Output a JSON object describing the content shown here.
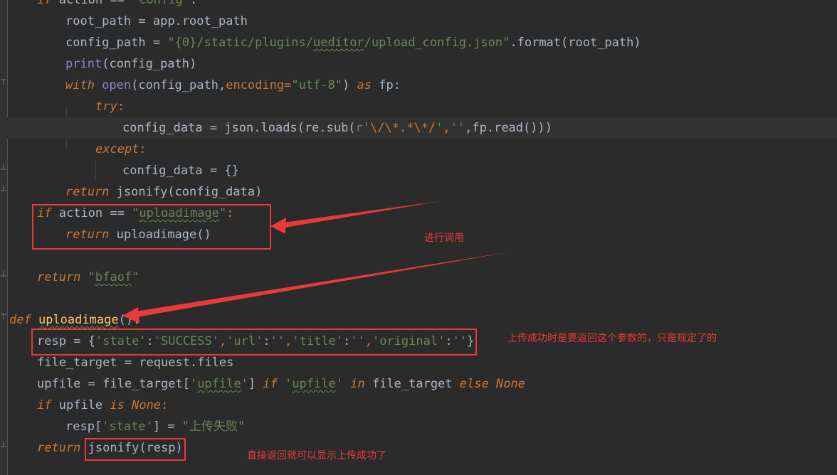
{
  "editor": {
    "lines": {
      "l0": "if action == \"config\":",
      "l1a": "root_path",
      "l1b": " = ",
      "l1c": "app.root_path",
      "l2a": "config_path",
      "l2b": " = ",
      "l2c": "\"{0}/static/plugins/",
      "l2d": "ueditor",
      "l2e": "/upload_config.json\"",
      "l2f": ".format(root_path)",
      "l3a": "print",
      "l3b": "(config_path)",
      "l4a": "with",
      "l4b": " open",
      "l4c": "(config_path,",
      "l4d": "encoding",
      "l4e": "=",
      "l4f": "\"utf-8\"",
      "l4g": ") ",
      "l4h": "as",
      "l4i": " fp:",
      "l5a": "try",
      "l5b": ":",
      "l6a": "config_data",
      "l6b": " = ",
      "l6c": "json.loads(re.sub(",
      "l6d": "r'",
      "l6e": "\\/\\*.*\\*/",
      "l6f": "'",
      "l6g": ",",
      "l6h": "''",
      "l6i": ",fp.read()))",
      "l7a": "except",
      "l7b": ":",
      "l8a": "config_data",
      "l8b": " = {}",
      "l9a": "return",
      "l9b": " jsonify(config_data)",
      "l10a": "if",
      "l10b": " action == ",
      "l10c": "\"",
      "l10d": "uploadimage",
      "l10e": "\"",
      "l10f": ":",
      "l11a": "return",
      "l11b": " uploadimage()",
      "l12a": "return",
      "l12b": " \"",
      "l12c": "bfaof",
      "l12d": "\"",
      "l13a": "def",
      "l13b": " ",
      "l13c": "uploadimage",
      "l13d": "():",
      "l14a": "resp = {",
      "l14b": "'state'",
      "l14c": ":",
      "l14d": "'SUCCESS'",
      "l14e": ",",
      "l14f": "'url'",
      "l14g": ":",
      "l14h": "''",
      "l14i": ",",
      "l14j": "'title'",
      "l14k": ":",
      "l14l": "''",
      "l14m": ",",
      "l14n": "'original'",
      "l14o": ":",
      "l14p": "''",
      "l14q": "}",
      "l15a": "file_target = request.files",
      "l16a": "upfile = file_target[",
      "l16b": "'",
      "l16c": "upfile",
      "l16d": "'",
      "l16e": "] ",
      "l16f": "if",
      "l16g": " '",
      "l16h": "upfile",
      "l16i": "' ",
      "l16j": "in",
      "l16k": " file_target ",
      "l16l": "else",
      "l16m": " None",
      "l17a": "if",
      "l17b": " upfile ",
      "l17c": "is",
      "l17d": " None",
      "l17e": ":",
      "l18a": "resp[",
      "l18b": "'state'",
      "l18c": "] = ",
      "l18d": "\"上传失败\"",
      "l19a": "return",
      "l19b": " ",
      "l19c": "jsonify(resp)"
    }
  },
  "annotations": {
    "note1": "进行调用",
    "note2": "上传成功时是要返回这个参数的，只是规定了的",
    "note3": "直接返回就可以显示上传成功了"
  },
  "colors": {
    "keyword": "#cc7832",
    "string": "#6a8759",
    "text": "#a9b7c6",
    "function_def": "#ffc66d",
    "annotation": "#e83a3a",
    "background": "#2b2b2b"
  }
}
